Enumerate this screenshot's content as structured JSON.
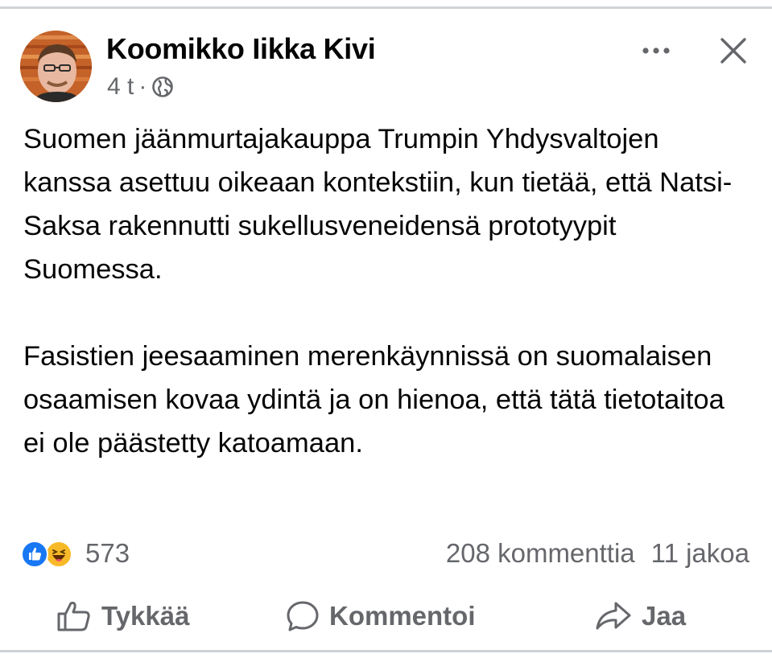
{
  "post": {
    "author": "Koomikko Iikka Kivi",
    "time": "4 t",
    "separator": "·",
    "audience_icon": "globe-icon",
    "paragraphs": [
      "Suomen jäänmurtajakauppa Trumpin Yhdysvaltojen kanssa asettuu oikeaan kontekstiin, kun tietää, että Natsi-Saksa rakennutti sukellusveneidensä prototyypit Suomessa.",
      "Fasistien jeesaaminen merenkäynnissä on suomalaisen osaamisen kovaa ydintä ja on hienoa, että tätä tietotaitoa ei ole päästetty katoamaan."
    ]
  },
  "header_actions": {
    "more_icon": "more-options-icon",
    "close_icon": "close-icon"
  },
  "stats": {
    "reactions": [
      "like-reaction-icon",
      "haha-reaction-icon"
    ],
    "reaction_count": "573",
    "comments": "208 kommenttia",
    "shares": "11 jakoa"
  },
  "actions": {
    "like_label": "Tykkää",
    "comment_label": "Kommentoi",
    "share_label": "Jaa"
  },
  "colors": {
    "text": "#050505",
    "secondary": "#65676b",
    "like_blue": "#1877f2",
    "haha_yellow": "#f7b928"
  }
}
